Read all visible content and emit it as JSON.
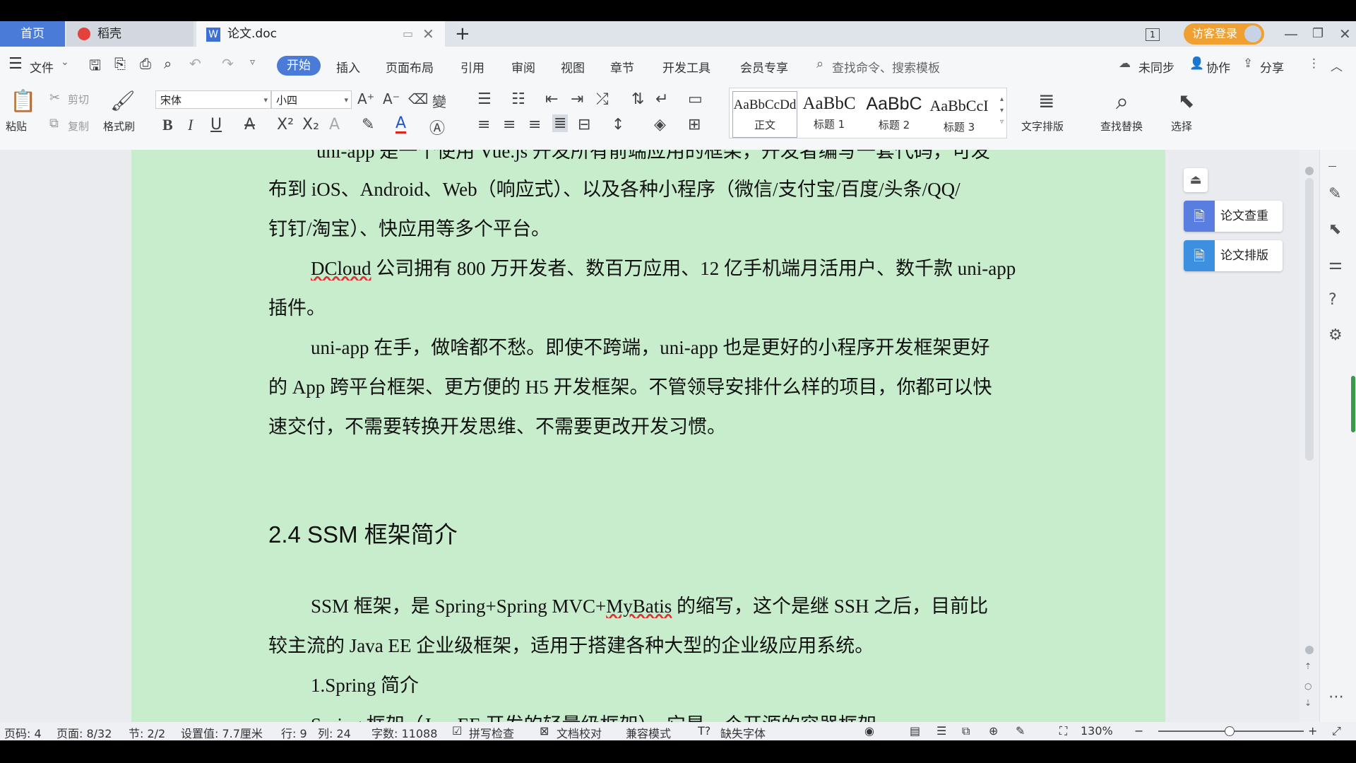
{
  "tabs": {
    "home": "首页",
    "daoke": "稻壳",
    "doc": "论文.doc",
    "new_tab": "+"
  },
  "titlebar": {
    "page_indicator": "1",
    "login_label": "访客登录"
  },
  "menu": {
    "file": "文件",
    "items": [
      "开始",
      "插入",
      "页面布局",
      "引用",
      "审阅",
      "视图",
      "章节",
      "开发工具",
      "会员专享"
    ],
    "search_placeholder": "查找命令、搜索模板",
    "sync": "未同步",
    "collab": "协作",
    "share": "分享"
  },
  "ribbon": {
    "paste": "粘贴",
    "cut": "剪切",
    "copy": "复制",
    "format_painter": "格式刷",
    "font_name": "宋体",
    "font_size": "小四",
    "styles": [
      {
        "sample": "AaBbCcDd",
        "name": "正文"
      },
      {
        "sample": "AaBbC",
        "name": "标题 1"
      },
      {
        "sample": "AaBbC",
        "name": "标题 2"
      },
      {
        "sample": "AaBbCcI",
        "name": "标题 3"
      }
    ],
    "text_layout": "文字排版",
    "find_replace": "查找替换",
    "select": "选择"
  },
  "document": {
    "line_top_partial": "uni-app 是一个使用 Vue.js 开发所有前端应用的框架，开发者编写一套代码，可发",
    "line1": "布到 iOS、Android、Web（响应式）、以及各种小程序（微信/支付宝/百度/头条/QQ/",
    "line2": "钉钉/淘宝）、快应用等多个平台。",
    "line3_a": "DCloud",
    "line3_b": " 公司拥有 800 万开发者、数百万应用、12 亿手机端月活用户、数千款 uni-app",
    "line4": "插件。",
    "line5": "uni-app 在手，做啥都不愁。即使不跨端，uni-app 也是更好的小程序开发框架更好",
    "line6": "的 App 跨平台框架、更方便的 H5 开发框架。不管领导安排什么样的项目，你都可以快",
    "line7": "速交付，不需要转换开发思维、不需要更改开发习惯。",
    "heading": "2.4 SSM 框架简介",
    "line8_a": "SSM 框架，是 Spring+Spring MVC+",
    "line8_b": "MyBatis",
    "line8_c": " 的缩写，这个是继 SSH 之后，目前比",
    "line9": "较主流的 Java EE 企业级框架，适用于搭建各种大型的企业级应用系统。",
    "line10": "1.Spring 简介",
    "line_bottom_partial": "Spring 框架（JavaEE 开发的轻量级框架），它是一个开源的容器框架"
  },
  "side_panel": {
    "check": "论文查重",
    "format": "论文排版"
  },
  "status": {
    "page_code": "页码: 4",
    "pages": "页面: 8/32",
    "section": "节: 2/2",
    "setting": "设置值: 7.7厘米",
    "row": "行: 9",
    "col": "列: 24",
    "word_count": "字数: 11088",
    "spell_check": "拼写检查",
    "proofread": "文档校对",
    "compat_mode": "兼容模式",
    "missing_font": "缺失字体",
    "zoom": "130%"
  },
  "colors": {
    "accent": "#4a7bd8",
    "page_bg": "#c7edcc",
    "login_orange": "#f0a030"
  }
}
